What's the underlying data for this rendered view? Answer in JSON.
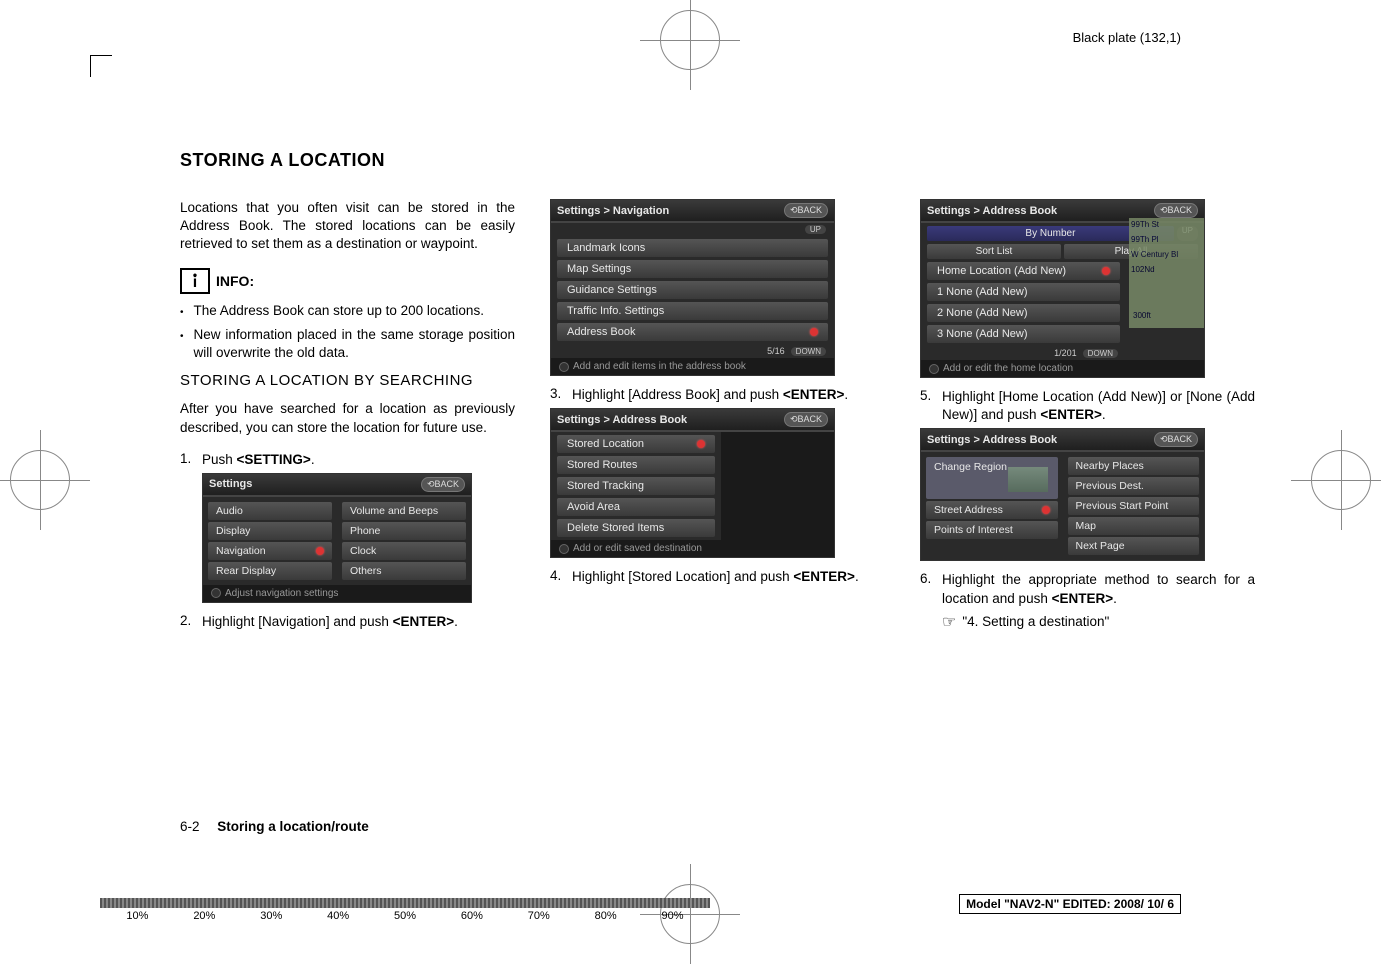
{
  "meta": {
    "black_plate": "Black plate (132,1)"
  },
  "section_title": "STORING A LOCATION",
  "col1": {
    "intro": "Locations that you often visit can be stored in the Address Book. The stored locations can be easily retrieved to set them as a destination or waypoint.",
    "info_label": "INFO:",
    "bullets": [
      "The Address Book can store up to 200 locations.",
      "New information placed in the same storage position will overwrite the old data."
    ],
    "subsection": "STORING A LOCATION BY SEARCHING",
    "after_sub": "After you have searched for a location as previously described, you can store the location for future use.",
    "step1_num": "1.",
    "step1": "Push <SETTING>.",
    "shot_settings": {
      "title": "Settings",
      "back": "BACK",
      "rows_left": [
        "Audio",
        "Display",
        "Navigation",
        "Rear Display"
      ],
      "rows_right": [
        "Volume and Beeps",
        "Phone",
        "Clock",
        "Others"
      ],
      "footer": "Adjust navigation settings"
    },
    "step2_num": "2.",
    "step2": "Highlight [Navigation] and push <ENTER>."
  },
  "col2": {
    "shot_nav": {
      "title": "Settings > Navigation",
      "back": "BACK",
      "up": "UP",
      "rows": [
        "Landmark Icons",
        "Map Settings",
        "Guidance Settings",
        "Traffic Info. Settings",
        "Address Book"
      ],
      "pager": "5/16",
      "down": "DOWN",
      "footer": "Add and edit items in the address book"
    },
    "step3_num": "3.",
    "step3": "Highlight [Address Book] and push <ENTER>.",
    "shot_addr": {
      "title": "Settings > Address Book",
      "back": "BACK",
      "rows": [
        "Stored Location",
        "Stored Routes",
        "Stored Tracking",
        "Avoid Area",
        "Delete Stored Items"
      ],
      "footer": "Add or edit saved destination"
    },
    "step4_num": "4.",
    "step4": "Highlight [Stored Location] and push <ENTER>."
  },
  "col3": {
    "shot_list": {
      "title": "Settings > Address Book",
      "back": "BACK",
      "tabs": [
        "By Number"
      ],
      "up": "UP",
      "sort": "Sort List",
      "play": "Play All",
      "home": "Home Location (Add New)",
      "rows": [
        "1  None (Add New)",
        "2  None (Add New)",
        "3  None (Add New)"
      ],
      "pager": "1/201",
      "down": "DOWN",
      "dist": "300ft",
      "map_labels": [
        "99Th St",
        "99Th Pl",
        "W Century Bl",
        "102Nd"
      ],
      "footer": "Add or edit the home location"
    },
    "step5_num": "5.",
    "step5": "Highlight [Home Location (Add New)] or [None (Add New)] and push <ENTER>.",
    "shot_search": {
      "title": "Settings > Address Book",
      "back": "BACK",
      "region": "Change Region",
      "left_rows": [
        "Street Address",
        "Points of Interest"
      ],
      "right_rows": [
        "Nearby Places",
        "Previous Dest.",
        "Previous Start Point",
        "Map",
        "Next Page"
      ]
    },
    "step6_num": "6.",
    "step6": "Highlight the appropriate method to search for a location and push <ENTER>.",
    "ref": "\"4. Setting a destination\""
  },
  "footer": {
    "pg": "6-2",
    "title": "Storing a location/route"
  },
  "model": {
    "label1": "Model \"",
    "name": "NAV2-N",
    "label2": "\"   EDITED:  2008/ 10/ 6"
  },
  "scale_labels": [
    "10%",
    "20%",
    "30%",
    "40%",
    "50%",
    "60%",
    "70%",
    "80%",
    "90%"
  ]
}
